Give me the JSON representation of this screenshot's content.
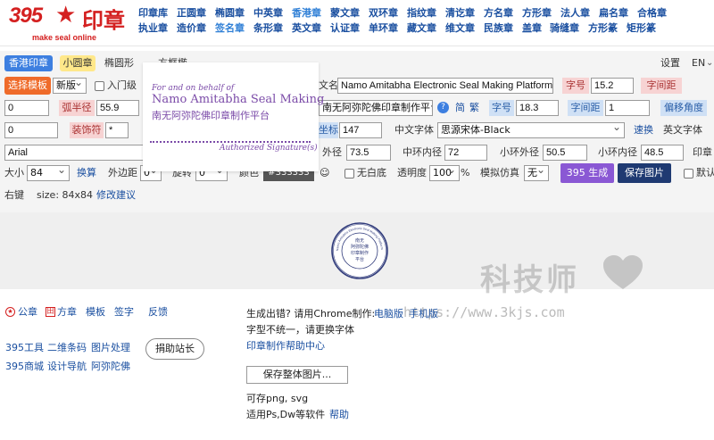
{
  "brand": {
    "number": "395",
    "star": "★",
    "name": "印章",
    "tagline": "make seal online"
  },
  "nav": {
    "row1": [
      "印章库",
      "正圆章",
      "椭圆章",
      "中英章",
      "香港章",
      "蒙文章",
      "双环章",
      "指纹章",
      "清讫章",
      "方名章",
      "方形章",
      "法人章",
      "扁名章",
      "合格章"
    ],
    "row2": [
      "执业章",
      "造价章",
      "签名章",
      "条形章",
      "英文章",
      "认证章",
      "单环章",
      "藏文章",
      "维文章",
      "民族章",
      "盖章",
      "骑缝章",
      "方形篆",
      "矩形篆"
    ],
    "active_row1": "香港章",
    "active_row2": "签名章"
  },
  "tabs": {
    "hk": "香港印章",
    "small_round": "小圆章",
    "ellipse": "椭圆形",
    "rect": "方框椭"
  },
  "settings": {
    "label": "设置",
    "lang": "EN"
  },
  "row_template": {
    "select_template": "选择模板",
    "version": "新版",
    "beginner": "入门级",
    "text_label": "文名",
    "text_value": "Namo Amitabha Electronic Seal Making Platform",
    "char_size_label": "字号",
    "char_size_value": "15.2",
    "char_spacing_label": "字间距"
  },
  "row_arc": {
    "left_value": "0",
    "arc_radius_label": "弧半径",
    "arc_radius_value": "55.9",
    "cn_text_value": "南无阿弥陀佛印章制作平台",
    "simplified": "简",
    "traditional": "繁",
    "char_size_label": "字号",
    "char_size_value": "18.3",
    "char_spacing_label": "字间距",
    "char_spacing_value": "1",
    "offset_label": "偏移角度"
  },
  "row_deco": {
    "left_value": "0",
    "deco_label": "装饰符",
    "deco_value": "*",
    "coord_label": "坐标",
    "coord_value": "147",
    "cn_font_label": "中文字体",
    "cn_font_value": "思源宋体-Black",
    "quick_change": "速换",
    "en_font_label": "英文字体"
  },
  "row_font": {
    "font_value": "Arial",
    "outer_ring_label": "外径",
    "outer_ring_value": "73.5",
    "mid_inner_label": "中环内径",
    "mid_inner_value": "72",
    "small_outer_label": "小环外径",
    "small_outer_value": "50.5",
    "small_inner_label": "小环内径",
    "small_inner_value": "48.5",
    "stamp_label": "印章"
  },
  "row_size": {
    "size_label": "大小",
    "size_value": "84",
    "swap": "换算",
    "outer_margin_label": "外边距",
    "outer_margin_value": "0",
    "rotate_label": "旋转",
    "rotate_value": "0",
    "color_label": "颜色",
    "color_value": "#333333",
    "no_white_label": "无白底",
    "opacity_label": "透明度",
    "opacity_value": "100",
    "percent": "%",
    "simulate_label": "模拟仿真",
    "simulate_value": "无",
    "generate": "395 生成",
    "save_image": "保存图片",
    "default_label": "默认"
  },
  "row_info": {
    "align": "右键",
    "size_info": "size: 84x84",
    "suggest": "修改建议"
  },
  "overlay": {
    "line1": "For and on behalf of",
    "line2": "Namo Amitabha Seal Making",
    "line3": "南无阿弥陀佛印章制作平台",
    "signature": "Authorized Signature(s)"
  },
  "seal": {
    "center_lines": [
      "南无",
      "阿弥陀佛",
      "印章制作",
      "平台"
    ],
    "ring_text": "Namo Amitabha Electronic Seal Making Platform",
    "color": "#2f3a7a"
  },
  "watermark": {
    "cn": "科技师",
    "url": "https://www.3kjs.com"
  },
  "footer": {
    "left": {
      "public_seal": "公章",
      "square_seal": "方章",
      "template": "模板",
      "signature": "签字",
      "feedback": "反馈",
      "tools": "395工具",
      "qrcode": "二维条码",
      "image_process": "图片处理",
      "donate": "捐助站长",
      "shop": "395商城",
      "design_nav": "设计导航",
      "amitabha": "阿弥陀佛"
    },
    "right": {
      "error_text": "生成出错? 请用Chrome制作:",
      "pc": "电脑版",
      "mobile": "手机版",
      "font_tip": "字型不统一，请更换字体",
      "help_center": "印章制作帮助中心",
      "save_whole": "保存整体图片...",
      "save_formats": "可存png, svg",
      "software": "适用Ps,Dw等软件",
      "help": "帮助"
    }
  },
  "colors": {
    "brand_red": "#d42020",
    "link_blue": "#1a4fa0",
    "seal_ink": "#2f3a7a",
    "overlay_purple": "#7b4ba8"
  }
}
